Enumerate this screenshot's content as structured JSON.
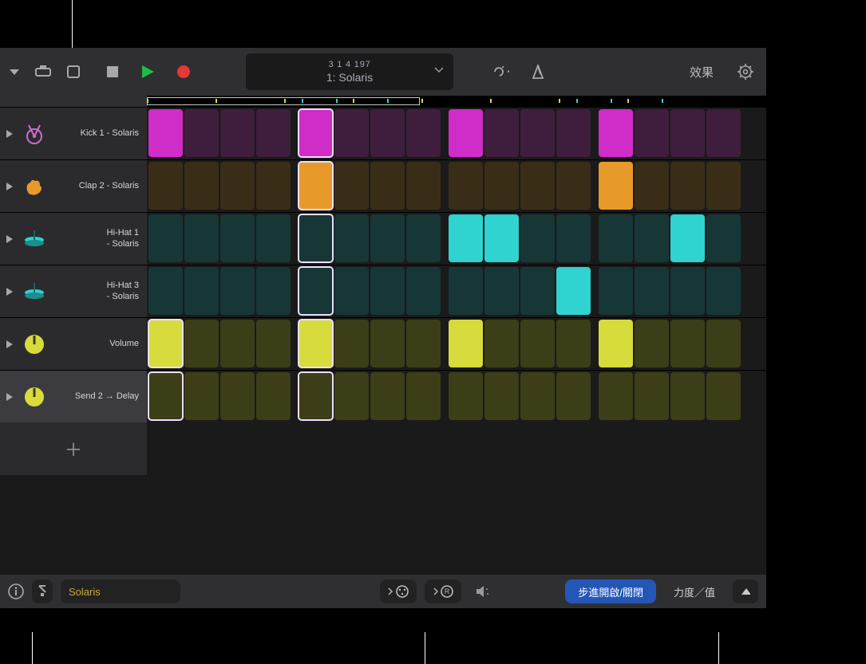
{
  "transport": {
    "position": "3  1  4  197",
    "pattern_name": "1: Solaris"
  },
  "toolbar": {
    "effects_label": "效果"
  },
  "rows": [
    {
      "id": "kick",
      "label": "Kick 1 - Solaris",
      "icon": "kick",
      "selected": false,
      "on_color": "#d02cc8",
      "off_color": "#3f1e3d",
      "steps": [
        1,
        0,
        0,
        0,
        1,
        0,
        0,
        0,
        1,
        0,
        0,
        0,
        1,
        0,
        0,
        0
      ],
      "highlights": [
        4
      ]
    },
    {
      "id": "clap",
      "label": "Clap 2 - Solaris",
      "icon": "clap",
      "selected": false,
      "on_color": "#e79a2a",
      "off_color": "#3a2d17",
      "steps": [
        0,
        0,
        0,
        0,
        1,
        0,
        0,
        0,
        0,
        0,
        0,
        0,
        1,
        0,
        0,
        0
      ],
      "highlights": [
        4
      ]
    },
    {
      "id": "hh1",
      "label": "Hi-Hat 1 - Solaris",
      "icon": "hat",
      "selected": false,
      "on_color": "#2fd3cf",
      "off_color": "#163736",
      "steps": [
        0,
        0,
        0,
        0,
        0,
        0,
        0,
        0,
        1,
        1,
        0,
        0,
        0,
        0,
        1,
        0
      ],
      "highlights": [
        4
      ]
    },
    {
      "id": "hh3",
      "label": "Hi-Hat 3 - Solaris",
      "icon": "hat",
      "selected": false,
      "on_color": "#2fd3cf",
      "off_color": "#163736",
      "steps": [
        0,
        0,
        0,
        0,
        0,
        0,
        0,
        0,
        0,
        0,
        0,
        1,
        0,
        0,
        0,
        0
      ],
      "highlights": [
        4
      ]
    },
    {
      "id": "vol",
      "label": "Volume",
      "icon": "knob-y",
      "selected": false,
      "on_color": "#d7db3c",
      "off_color": "#3c3e17",
      "steps": [
        1,
        0,
        0,
        0,
        1,
        0,
        0,
        0,
        1,
        0,
        0,
        0,
        1,
        0,
        0,
        0
      ],
      "highlights": [
        0,
        4
      ]
    },
    {
      "id": "send",
      "label": "Send 2 → Delay",
      "icon": "knob-y",
      "selected": true,
      "on_color": "#d7db3c",
      "off_color": "#3c3e17",
      "steps": [
        0,
        0,
        0,
        0,
        0,
        0,
        0,
        0,
        0,
        0,
        0,
        0,
        0,
        0,
        0,
        0
      ],
      "highlights": [
        0,
        4
      ]
    }
  ],
  "bottom": {
    "preset_name": "Solaris",
    "step_toggle_label": "步進開啟/關閉",
    "velocity_label": "力度／值"
  },
  "colors": {
    "play_green": "#1fbd47",
    "record_red": "#e33939",
    "selected_bg": "#3c3c40"
  },
  "chart_data": null
}
